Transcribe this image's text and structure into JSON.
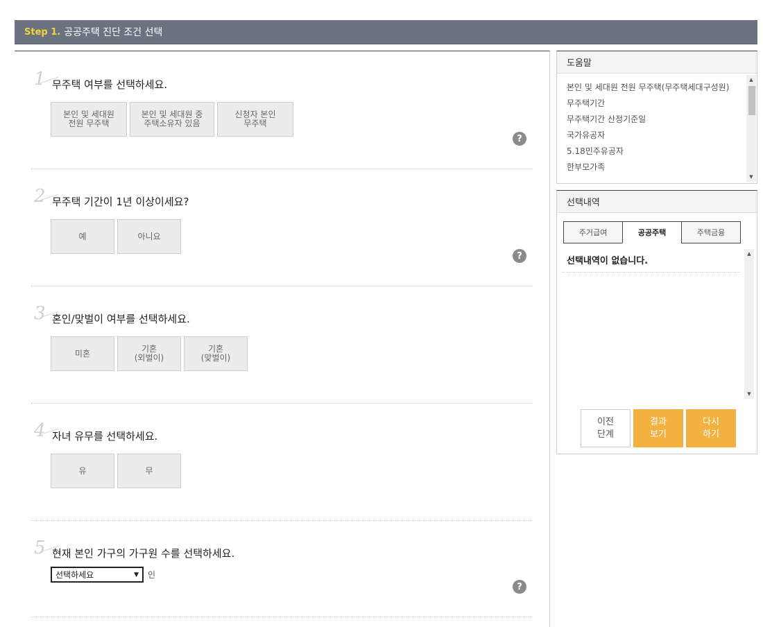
{
  "header": {
    "step_label": "Step 1.",
    "title": "공공주택 진단 조건 선택"
  },
  "questions": [
    {
      "num": "1",
      "title": "무주택 여부를 선택하세요.",
      "options": [
        "본인 및 세대원\n전원 무주택",
        "본인 및 세대원 중\n주택소유자 있음",
        "신청자 본인\n무주택"
      ]
    },
    {
      "num": "2",
      "title": "무주택 기간이 1년 이상이세요?",
      "options": [
        "예",
        "아니요"
      ]
    },
    {
      "num": "3",
      "title": "혼인/맞벌이 여부를 선택하세요.",
      "options": [
        "미혼",
        "기혼\n(외벌이)",
        "기혼\n(맞벌이)"
      ]
    },
    {
      "num": "4",
      "title": "자녀 유무를 선택하세요.",
      "options": [
        "유",
        "무"
      ]
    },
    {
      "num": "5",
      "title": "현재 본인 가구의 가구원 수를 선택하세요.",
      "select_value": "선택하세요",
      "unit": "인"
    }
  ],
  "help_icon_glyph": "?",
  "help_box": {
    "title": "도움말",
    "items": [
      "본인 및 세대원 전원 무주택(무주택세대구성원)",
      "무주택기간",
      "무주택기간 산정기준일",
      "국가유공자",
      "5.18민주유공자",
      "한부모가족"
    ]
  },
  "selection_box": {
    "title": "선택내역",
    "tabs": [
      "주거급여",
      "공공주택",
      "주택금융"
    ],
    "active_tab": 1,
    "empty_text": "선택내역이 없습니다."
  },
  "buttons": {
    "prev": "이전\n단계",
    "result": "결과\n보기",
    "reset": "다시\n하기"
  },
  "colors": {
    "header_bg": "#6b7280",
    "step_label": "#f5d33b",
    "accent": "#f3b23f"
  }
}
